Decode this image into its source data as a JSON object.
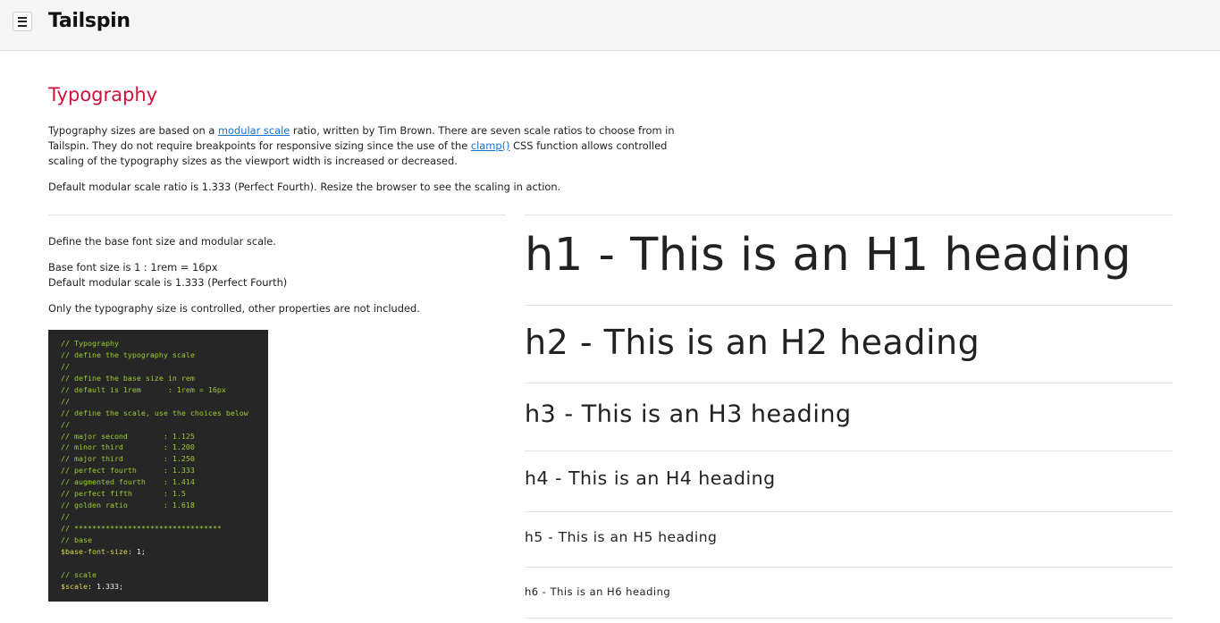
{
  "header": {
    "menu_icon": "hamburger-menu-icon",
    "brand": "Tailspin"
  },
  "content": {
    "title": "Typography",
    "intro": {
      "text1": "Typography sizes are based on a ",
      "link1": "modular scale",
      "text2": " ratio, written by Tim Brown. There are seven scale ratios to choose from in Tailspin. They do not require breakpoints for responsive sizing since the use of the ",
      "link2": "clamp()",
      "text3": " CSS function allows controlled scaling of the typography sizes as the viewport width is increased or decreased."
    },
    "default_ratio": "Default modular scale ratio is 1.333 (Perfect Fourth). Resize the browser to see the scaling in action.",
    "left": {
      "define": "Define the base font size and modular scale.",
      "base_size": "Base font size is 1 : 1rem = 16px",
      "default_scale": "Default modular scale is 1.333 (Perfect Fourth)",
      "only_size": "Only the typography size is controlled, other properties are not included."
    },
    "code_lines": [
      "// Typography",
      "// define the typography scale",
      "//",
      "// define the base size in rem",
      "// default is 1rem      : 1rem = 16px",
      "//",
      "// define the scale, use the choices below",
      "//",
      "// major second        : 1.125",
      "// minor third         : 1.200",
      "// major third         : 1.250",
      "// perfect fourth      : 1.333",
      "// augmented fourth    : 1.414",
      "// perfect fifth       : 1.5",
      "// golden ratio        : 1.618",
      "//",
      "// *********************************",
      "// base",
      "$base-font-size: 1;",
      "",
      "// scale",
      "$scale: 1.333;"
    ],
    "headings": {
      "h1": "h1 - This is an H1 heading",
      "h2": "h2 - This is an H2 heading",
      "h3": "h3 - This is an H3 heading",
      "h4": "h4 - This is an H4 heading",
      "h5": "h5 - This is an H5 heading",
      "h6": "h6 - This is an H6 heading"
    }
  },
  "colors": {
    "title_accent": "#d0113a",
    "link": "#1a73c9",
    "code_background": "#262626",
    "code_comment": "#9acd32"
  }
}
